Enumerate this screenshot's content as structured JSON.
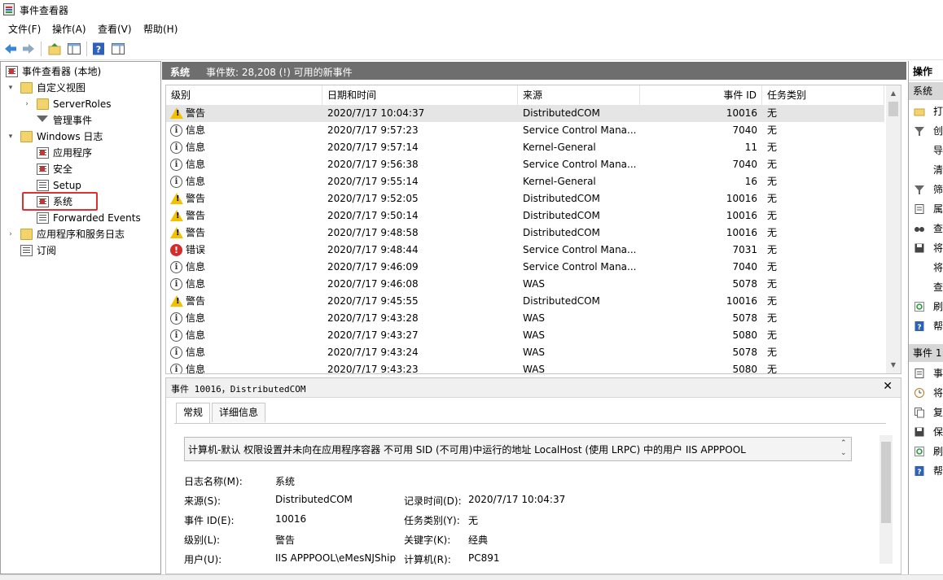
{
  "window": {
    "title": "事件查看器"
  },
  "menu": [
    "文件(F)",
    "操作(A)",
    "查看(V)",
    "帮助(H)"
  ],
  "tree": {
    "root": "事件查看器 (本地)",
    "items": [
      {
        "label": "自定义视图",
        "level": 1,
        "twisty": "▾",
        "icon": "folder"
      },
      {
        "label": "ServerRoles",
        "level": 2,
        "twisty": "›",
        "icon": "folder"
      },
      {
        "label": "管理事件",
        "level": 2,
        "twisty": "",
        "icon": "filter"
      },
      {
        "label": "Windows 日志",
        "level": 1,
        "twisty": "▾",
        "icon": "folder"
      },
      {
        "label": "应用程序",
        "level": 2,
        "twisty": "",
        "icon": "log-red"
      },
      {
        "label": "安全",
        "level": 2,
        "twisty": "",
        "icon": "log-red"
      },
      {
        "label": "Setup",
        "level": 2,
        "twisty": "",
        "icon": "log"
      },
      {
        "label": "系统",
        "level": 2,
        "twisty": "",
        "icon": "log-red",
        "selected": true
      },
      {
        "label": "Forwarded Events",
        "level": 2,
        "twisty": "",
        "icon": "log"
      },
      {
        "label": "应用程序和服务日志",
        "level": 1,
        "twisty": "›",
        "icon": "folder"
      },
      {
        "label": "订阅",
        "level": 1,
        "twisty": "",
        "icon": "log"
      }
    ]
  },
  "center": {
    "title": "系统",
    "count": "事件数: 28,208 (!) 可用的新事件"
  },
  "columns": [
    "级别",
    "日期和时间",
    "来源",
    "事件 ID",
    "任务类别"
  ],
  "events": [
    {
      "level": "警告",
      "type": "warn",
      "datetime": "2020/7/17 10:04:37",
      "source": "DistributedCOM",
      "id": "10016",
      "task": "无",
      "selected": true
    },
    {
      "level": "信息",
      "type": "info",
      "datetime": "2020/7/17 9:57:23",
      "source": "Service Control Mana...",
      "id": "7040",
      "task": "无"
    },
    {
      "level": "信息",
      "type": "info",
      "datetime": "2020/7/17 9:57:14",
      "source": "Kernel-General",
      "id": "11",
      "task": "无"
    },
    {
      "level": "信息",
      "type": "info",
      "datetime": "2020/7/17 9:56:38",
      "source": "Service Control Mana...",
      "id": "7040",
      "task": "无"
    },
    {
      "level": "信息",
      "type": "info",
      "datetime": "2020/7/17 9:55:14",
      "source": "Kernel-General",
      "id": "16",
      "task": "无"
    },
    {
      "level": "警告",
      "type": "warn",
      "datetime": "2020/7/17 9:52:05",
      "source": "DistributedCOM",
      "id": "10016",
      "task": "无"
    },
    {
      "level": "警告",
      "type": "warn",
      "datetime": "2020/7/17 9:50:14",
      "source": "DistributedCOM",
      "id": "10016",
      "task": "无"
    },
    {
      "level": "警告",
      "type": "warn",
      "datetime": "2020/7/17 9:48:58",
      "source": "DistributedCOM",
      "id": "10016",
      "task": "无"
    },
    {
      "level": "错误",
      "type": "err",
      "datetime": "2020/7/17 9:48:44",
      "source": "Service Control Mana...",
      "id": "7031",
      "task": "无"
    },
    {
      "level": "信息",
      "type": "info",
      "datetime": "2020/7/17 9:46:09",
      "source": "Service Control Mana...",
      "id": "7040",
      "task": "无"
    },
    {
      "level": "信息",
      "type": "info",
      "datetime": "2020/7/17 9:46:08",
      "source": "WAS",
      "id": "5078",
      "task": "无"
    },
    {
      "level": "警告",
      "type": "warn",
      "datetime": "2020/7/17 9:45:55",
      "source": "DistributedCOM",
      "id": "10016",
      "task": "无"
    },
    {
      "level": "信息",
      "type": "info",
      "datetime": "2020/7/17 9:43:28",
      "source": "WAS",
      "id": "5078",
      "task": "无"
    },
    {
      "level": "信息",
      "type": "info",
      "datetime": "2020/7/17 9:43:27",
      "source": "WAS",
      "id": "5080",
      "task": "无"
    },
    {
      "level": "信息",
      "type": "info",
      "datetime": "2020/7/17 9:43:24",
      "source": "WAS",
      "id": "5078",
      "task": "无"
    },
    {
      "level": "信息",
      "type": "info",
      "datetime": "2020/7/17 9:43:23",
      "source": "WAS",
      "id": "5080",
      "task": "无"
    }
  ],
  "detail": {
    "title": "事件 10016，DistributedCOM",
    "tabs": [
      "常规",
      "详细信息"
    ],
    "message": "计算机-默认 权限设置并未向在应用程序容器 不可用 SID (不可用)中运行的地址 LocalHost (使用 LRPC) 中的用户 IIS APPPOOL",
    "fields_left": [
      {
        "label": "日志名称(M):",
        "value": "系统"
      },
      {
        "label": "来源(S):",
        "value": "DistributedCOM"
      },
      {
        "label": "事件 ID(E):",
        "value": "10016"
      },
      {
        "label": "级别(L):",
        "value": "警告"
      },
      {
        "label": "用户(U):",
        "value": "IIS APPPOOL\\eMesNJShip"
      }
    ],
    "fields_right": [
      {
        "label": "记录时间(D):",
        "value": "2020/7/17 10:04:37"
      },
      {
        "label": "任务类别(Y):",
        "value": "无"
      },
      {
        "label": "关键字(K):",
        "value": "经典"
      },
      {
        "label": "计算机(R):",
        "value": "PC891"
      }
    ]
  },
  "actions": {
    "header": "操作",
    "section1": "系统",
    "items1": [
      {
        "label": "打",
        "icon": "open-icon"
      },
      {
        "label": "创",
        "icon": "filter-icon"
      },
      {
        "label": "导",
        "icon": ""
      },
      {
        "label": "清",
        "icon": ""
      },
      {
        "label": "筛",
        "icon": "filter-icon"
      },
      {
        "label": "属",
        "icon": "properties-icon"
      },
      {
        "label": "查",
        "icon": "find-icon"
      },
      {
        "label": "将",
        "icon": "save-icon"
      },
      {
        "label": "将",
        "icon": ""
      },
      {
        "label": "查",
        "icon": ""
      },
      {
        "label": "刷",
        "icon": "refresh-icon"
      },
      {
        "label": "帮",
        "icon": "help-icon"
      }
    ],
    "section2": "事件 1",
    "items2": [
      {
        "label": "事",
        "icon": "properties-icon"
      },
      {
        "label": "将",
        "icon": "task-icon"
      },
      {
        "label": "复",
        "icon": "copy-icon"
      },
      {
        "label": "保",
        "icon": "save-icon"
      },
      {
        "label": "刷",
        "icon": "refresh-icon"
      },
      {
        "label": "帮",
        "icon": "help-icon"
      }
    ]
  },
  "colors": {
    "header_bg": "#6e6e6e",
    "selection": "#e5e5e5",
    "highlight_box": "#e03131",
    "warning": "#f2c200",
    "error": "#d62b2b"
  }
}
